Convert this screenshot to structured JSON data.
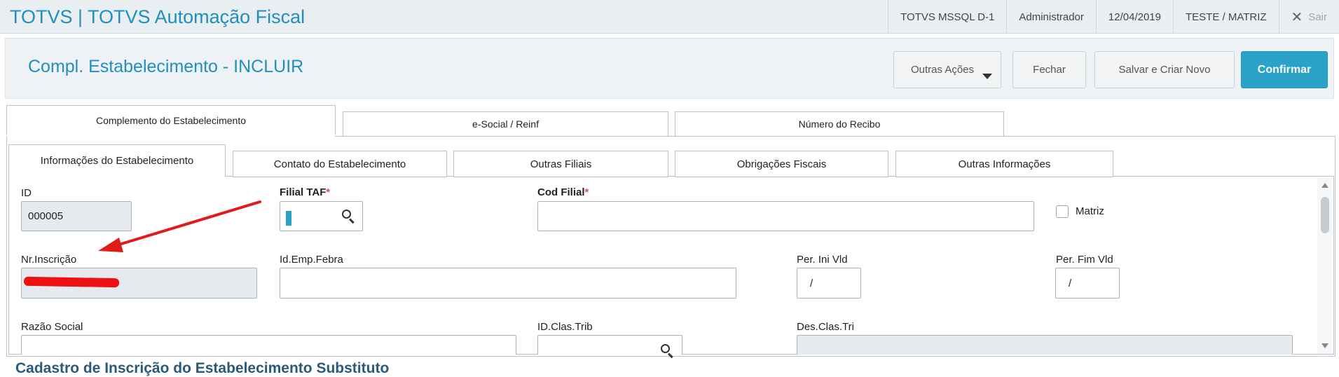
{
  "app": {
    "title": "TOTVS | TOTVS Automação Fiscal",
    "environment": "TOTVS  MSSQL D-1",
    "user": "Administrador",
    "date": "12/04/2019",
    "company": "TESTE / MATRIZ",
    "logout_label": "Sair"
  },
  "page": {
    "title": "Compl. Estabelecimento - INCLUIR"
  },
  "toolbar": {
    "other_actions_label": "Outras Ações",
    "close_label": "Fechar",
    "save_new_label": "Salvar e Criar Novo",
    "confirm_label": "Confirmar",
    "confirm_color": "#2ba3c8"
  },
  "main_tabs": [
    {
      "label": "Complemento do Estabelecimento",
      "active": true
    },
    {
      "label": "e-Social / Reinf",
      "active": false
    },
    {
      "label": "Número do Recibo",
      "active": false
    }
  ],
  "sub_tabs": [
    {
      "label": "Informações do Estabelecimento",
      "active": true
    },
    {
      "label": "Contato do Estabelecimento",
      "active": false
    },
    {
      "label": "Outras Filiais",
      "active": false
    },
    {
      "label": "Obrigações Fiscais",
      "active": false
    },
    {
      "label": "Outras Informações",
      "active": false
    }
  ],
  "form": {
    "id_label": "ID",
    "id_value": "000005",
    "filial_taf_label": "Filial TAF",
    "filial_taf_value": "",
    "cod_filial_label": "Cod Filial",
    "cod_filial_value": "",
    "required_mark": "*",
    "matriz_label": "Matriz",
    "matriz_checked": false,
    "nr_inscricao_label": "Nr.Inscrição",
    "id_emp_febra_label": "Id.Emp.Febra",
    "id_emp_febra_value": "",
    "per_ini_label": "Per. Ini Vld",
    "per_ini_value": "/",
    "per_fim_label": "Per. Fim Vld",
    "per_fim_value": "/",
    "razao_social_label": "Razão Social",
    "id_clas_trib_label": "ID.Clas.Trib",
    "des_clas_tri_label": "Des.Clas.Tri"
  },
  "section": {
    "title": "Cadastro de Inscrição do Estabelecimento Substituto"
  },
  "icons": {
    "search": "search-icon",
    "close": "close-icon",
    "dropdown": "caret-down-icon"
  }
}
